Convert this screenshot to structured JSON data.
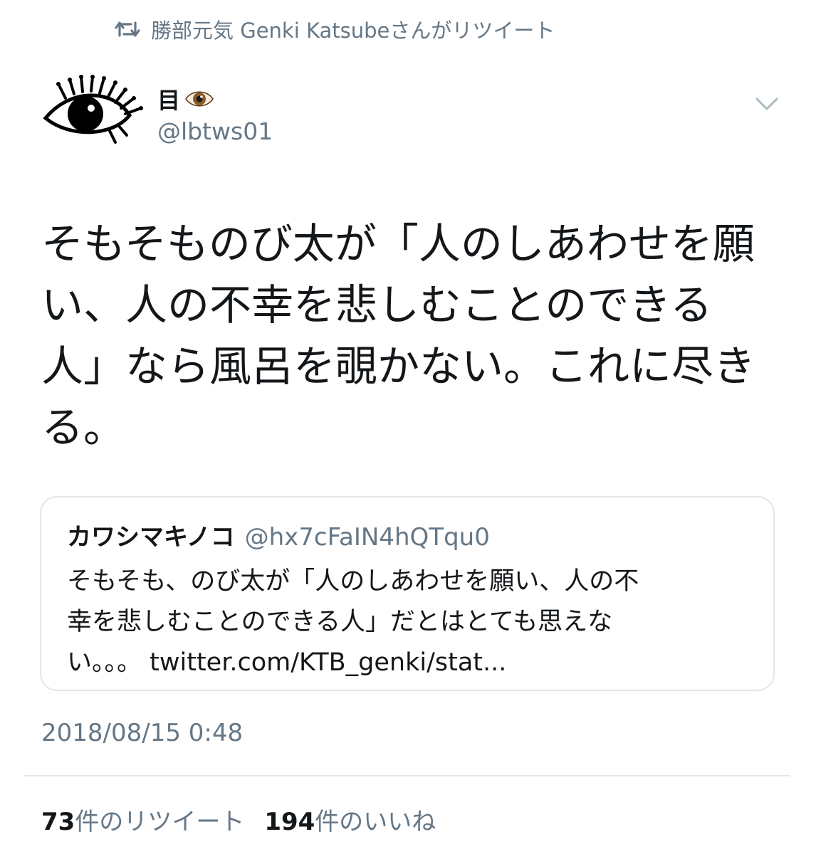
{
  "retweet_banner": {
    "icon": "retweet-icon",
    "text": "勝部元気 Genki Katsubeさんがリツイート"
  },
  "author": {
    "avatar": "eye-avatar",
    "name": "目",
    "name_emoji": "eye-emoji",
    "handle": "@lbtws01"
  },
  "menu": {
    "icon": "chevron-down-icon"
  },
  "tweet": {
    "lines": [
      "そもそものび太が「人のしあわせを願",
      "い、人の不幸を悲しむことのできる",
      "人」なら風呂を覗かない。これに尽き",
      "る。"
    ]
  },
  "quote": {
    "name": "カワシマキノコ",
    "handle": "@hx7cFaIN4hQTqu0",
    "lines": [
      "そもそも、のび太が「人のしあわせを願い、人の不",
      "幸を悲しむことのできる人」だとはとても思えな"
    ],
    "last_line_prefix": "い。。。",
    "link": "twitter.com/KTB_genki/stat..."
  },
  "timestamp": "2018/08/15 0:48",
  "stats": {
    "retweets_count": "73",
    "retweets_label": "件のリツイート",
    "likes_count": "194",
    "likes_label": "件のいいね"
  }
}
